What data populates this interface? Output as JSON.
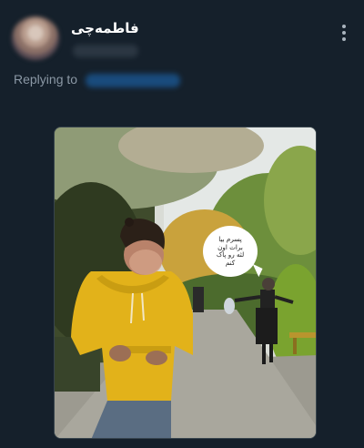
{
  "tweet": {
    "display_name": "فاطمه‌چی",
    "reply_prefix": "Replying to"
  },
  "media": {
    "speech_bubble_text": "پسرم بیا\nبرات اون\nلثه رو پاک\nکنم"
  },
  "icons": {
    "more": "more-vertical-icon"
  },
  "colors": {
    "background": "#15202b",
    "secondary_text": "#8b98a5",
    "link": "#1d9bf0"
  }
}
